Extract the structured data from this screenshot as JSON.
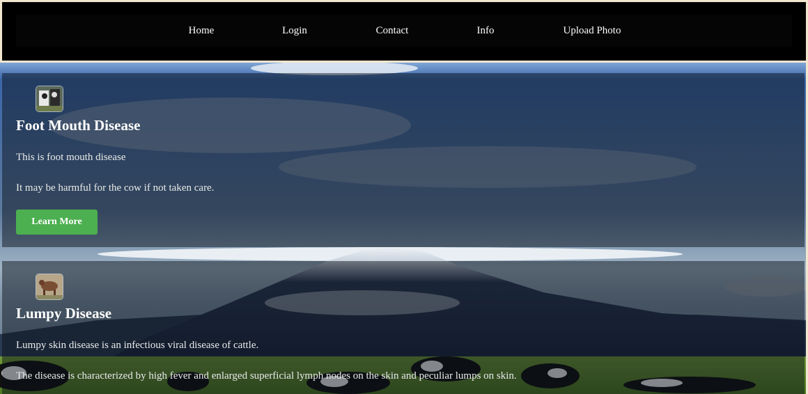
{
  "nav": {
    "items": [
      {
        "label": "Home"
      },
      {
        "label": "Login"
      },
      {
        "label": "Contact"
      },
      {
        "label": "Info"
      },
      {
        "label": "Upload Photo"
      }
    ]
  },
  "diseases": [
    {
      "icon": "cow-thumbnail-icon",
      "title": "Foot Mouth Disease",
      "line1": "This is foot mouth disease",
      "line2": "It may be harmful for the cow if not taken care.",
      "button_label": "Learn More"
    },
    {
      "icon": "cow-thumbnail-icon",
      "title": "Lumpy Disease",
      "line1": "Lumpy skin disease is an infectious viral disease of cattle.",
      "line2": "The disease is characterized by high fever and enlarged superficial lymph nodes on the skin and peculiar lumps on skin."
    }
  ],
  "colors": {
    "header_border": "#f3e6cf",
    "navbar_bg": "#000000",
    "button_green": "#4caf50",
    "card_overlay": "rgba(8,14,22,0.48)"
  }
}
